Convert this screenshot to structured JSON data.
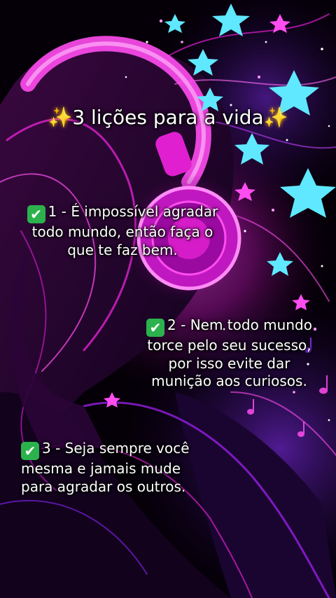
{
  "title": {
    "sparkle_left": "✨",
    "text": "3 lições para a vida",
    "sparkle_right": "✨"
  },
  "lessons": [
    {
      "check": "✔",
      "lines": [
        "1 - É impossível agradar",
        "todo mundo, então faça o",
        "que te faz bem."
      ]
    },
    {
      "check": "✔",
      "lines": [
        "2 - Nem todo mundo",
        "torce pelo seu sucesso,",
        "por isso evite dar",
        "munição aos curiosos."
      ]
    },
    {
      "check": "✔",
      "lines": [
        "3 - Seja sempre você",
        "mesma e jamais mude",
        "para agradar os outros."
      ]
    }
  ],
  "colors": {
    "background": "#000000",
    "magenta": "#e020d0",
    "pink_glow": "#ff4df0",
    "purple": "#7a20e0",
    "cyan_stars": "#5fe8ff",
    "check_green": "#2bb24c",
    "text": "#ffffff"
  },
  "illustration": "neon-girl-with-headphones-and-stars"
}
